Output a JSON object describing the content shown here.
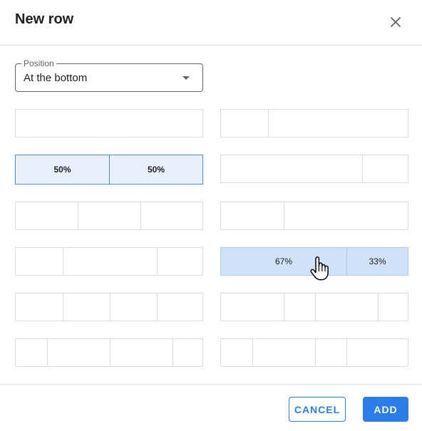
{
  "dialog": {
    "title": "New row",
    "close_icon": "close-icon"
  },
  "position": {
    "label": "Position",
    "value": "At the bottom",
    "caret_icon": "caret-down-icon"
  },
  "layouts": {
    "left": [
      {
        "name": "layout-1-col",
        "cells": [
          ""
        ]
      },
      {
        "name": "layout-50-50",
        "cells": [
          "50%",
          "50%"
        ],
        "selected": true
      },
      {
        "name": "layout-3-equal",
        "cells": [
          "",
          "",
          ""
        ]
      },
      {
        "name": "layout-25-50-25",
        "cells": [
          "",
          "",
          ""
        ]
      },
      {
        "name": "layout-4-equal",
        "cells": [
          "",
          "",
          "",
          ""
        ]
      },
      {
        "name": "layout-1-2-2-1",
        "cells": [
          "",
          "",
          "",
          ""
        ]
      }
    ],
    "right": [
      {
        "name": "layout-25-75",
        "cells": [
          "",
          ""
        ]
      },
      {
        "name": "layout-75-25",
        "cells": [
          "",
          ""
        ]
      },
      {
        "name": "layout-33-67",
        "cells": [
          "",
          ""
        ]
      },
      {
        "name": "layout-67-33",
        "cells": [
          "67%",
          "33%"
        ],
        "hovered": true
      },
      {
        "name": "layout-2-1-2-1",
        "cells": [
          "",
          "",
          "",
          ""
        ]
      },
      {
        "name": "layout-1-2-1-2",
        "cells": [
          "",
          "",
          "",
          ""
        ]
      }
    ]
  },
  "footer": {
    "cancel_label": "CANCEL",
    "add_label": "ADD"
  },
  "colors": {
    "accent": "#2b7de9",
    "selected_bg": "#e8f0fe",
    "hovered_bg": "#cfe2f8"
  },
  "cursor_icon": "hand-pointer-icon"
}
